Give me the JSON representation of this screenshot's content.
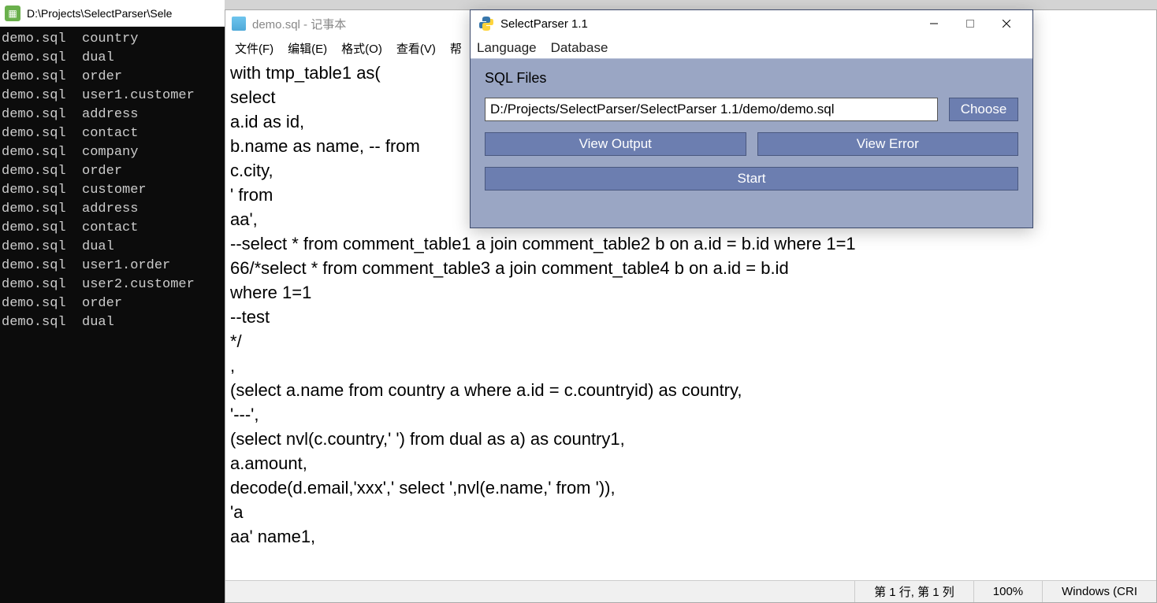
{
  "terminal": {
    "title": "D:\\Projects\\SelectParser\\Sele",
    "lines": [
      "demo.sql  country",
      "demo.sql  dual",
      "demo.sql  order",
      "demo.sql  user1.customer",
      "demo.sql  address",
      "demo.sql  contact",
      "demo.sql  company",
      "demo.sql  order",
      "demo.sql  customer",
      "demo.sql  address",
      "demo.sql  contact",
      "demo.sql  dual",
      "demo.sql  user1.order",
      "demo.sql  user2.customer",
      "demo.sql  order",
      "demo.sql  dual"
    ]
  },
  "notepad": {
    "title": "demo.sql - 记事本",
    "menu": {
      "file": "文件(F)",
      "edit": "编辑(E)",
      "format": "格式(O)",
      "view": "查看(V)",
      "help": "帮"
    },
    "content": "with tmp_table1 as(\nselect\na.id as id,\nb.name as name, -- from\nc.city,\n' from\naa',\n--select * from comment_table1 a join comment_table2 b on a.id = b.id where 1=1\n66/*select * from comment_table3 a join comment_table4 b on a.id = b.id\nwhere 1=1\n--test\n*/\n,\n(select a.name from country a where a.id = c.countryid) as country,\n'---',\n(select nvl(c.country,' ') from dual as a) as country1,\na.amount,\ndecode(d.email,'xxx',' select ',nvl(e.name,' from ')),\n'a\naa' name1,",
    "status": {
      "pos": "第 1 行, 第 1 列",
      "zoom": "100%",
      "encoding": "Windows (CRI"
    }
  },
  "parser": {
    "title": "SelectParser 1.1",
    "menu": {
      "lang": "Language",
      "db": "Database"
    },
    "label": "SQL Files",
    "path": "D:/Projects/SelectParser/SelectParser 1.1/demo/demo.sql",
    "buttons": {
      "choose": "Choose",
      "viewOutput": "View Output",
      "viewError": "View Error",
      "start": "Start"
    }
  }
}
